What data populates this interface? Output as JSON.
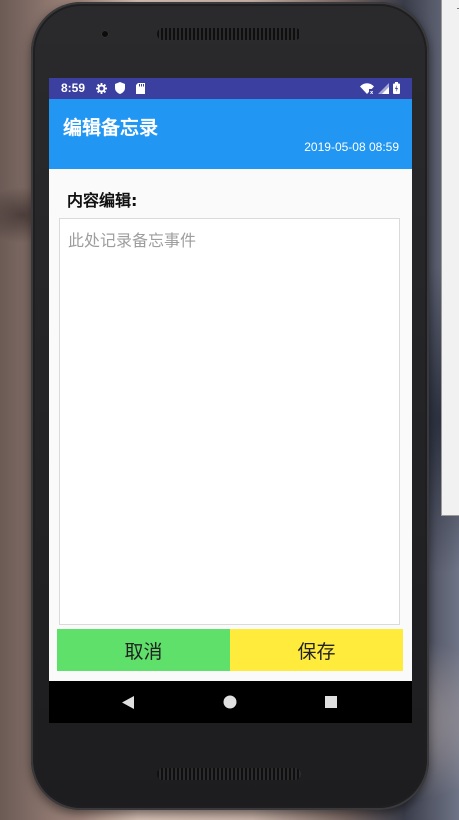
{
  "status_bar": {
    "time": "8:59",
    "icons": [
      "gear-icon",
      "shield-icon",
      "sd-card-icon",
      "wifi-icon",
      "cell-signal-icon",
      "battery-icon"
    ]
  },
  "app_bar": {
    "title": "编辑备忘录",
    "date": "2019-05-08 08:59"
  },
  "editor": {
    "label": "内容编辑:",
    "value": "",
    "placeholder": "此处记录备忘事件"
  },
  "buttons": {
    "cancel_label": "取消",
    "save_label": "保存"
  },
  "nav_bar": {
    "icons": [
      "back-icon",
      "home-icon",
      "recents-icon"
    ]
  },
  "colors": {
    "status_bar": "#3a3fa0",
    "app_bar": "#2196f3",
    "cancel_button": "#5ee06a",
    "save_button": "#ffeb3b",
    "nav_bar": "#000000"
  }
}
